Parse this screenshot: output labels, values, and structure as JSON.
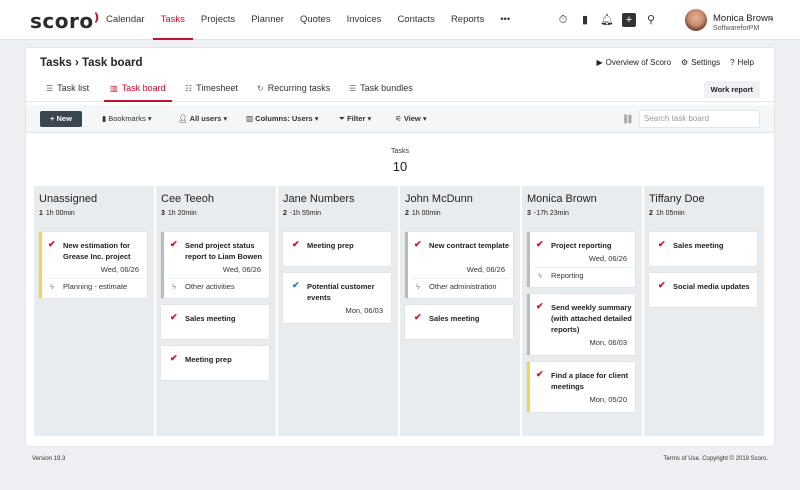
{
  "app": {
    "logo": "scoro"
  },
  "nav": {
    "items": [
      "Calendar",
      "Tasks",
      "Projects",
      "Planner",
      "Quotes",
      "Invoices",
      "Contacts",
      "Reports"
    ],
    "more": "•••",
    "active": "Tasks"
  },
  "top_icons": [
    "stopwatch-icon",
    "bookmark-icon",
    "bell-icon",
    "plus-icon",
    "search-icon"
  ],
  "user": {
    "name": "Monica Brown",
    "org": "SoftwareforPM",
    "caret": "⌄"
  },
  "page": {
    "breadcrumb": "Tasks › Task board",
    "overview": "Overview of Scoro",
    "settings": "Settings",
    "help": "Help"
  },
  "tabs": [
    {
      "label": "Task list",
      "icon": "list-icon"
    },
    {
      "label": "Task board",
      "icon": "board-icon"
    },
    {
      "label": "Timesheet",
      "icon": "timesheet-icon"
    },
    {
      "label": "Recurring tasks",
      "icon": "recurring-icon"
    },
    {
      "label": "Task bundles",
      "icon": "bundle-icon"
    }
  ],
  "work_report": "Work report",
  "toolbar": {
    "new_label": "+ New",
    "bookmarks": "Bookmarks",
    "all_users": "All users",
    "columns_prefix": "Columns:",
    "columns_value": "Users",
    "filter": "Filter",
    "view": "View",
    "search_placeholder": "Search task board"
  },
  "counter": {
    "label": "Tasks",
    "value": "10"
  },
  "columns": [
    {
      "name": "Unassigned",
      "count": "1",
      "time": "1h 00min",
      "cards": [
        {
          "title": "New estimation for Grease Inc. project",
          "date": "Wed, 06/26",
          "tag": "Planning - estimate",
          "border": "yellow",
          "check": "red"
        }
      ]
    },
    {
      "name": "Cee Teeoh",
      "count": "3",
      "time": "1h 20min",
      "cards": [
        {
          "title": "Send project status report to Liam Bowen",
          "date": "Wed, 06/26",
          "tag": "Other activities",
          "border": "gray",
          "check": "red"
        },
        {
          "title": "Sales meeting",
          "border": "none",
          "check": "red"
        },
        {
          "title": "Meeting prep",
          "border": "none",
          "check": "red"
        }
      ]
    },
    {
      "name": "Jane Numbers",
      "count": "2",
      "time": "-1h 55min",
      "cards": [
        {
          "title": "Meeting prep",
          "border": "none",
          "check": "red"
        },
        {
          "title": "Potential customer events",
          "date": "Mon, 06/03",
          "border": "none",
          "check": "blue"
        }
      ]
    },
    {
      "name": "John McDunn",
      "count": "2",
      "time": "1h 00min",
      "cards": [
        {
          "title": "New contract template",
          "date": "Wed, 06/26",
          "tag": "Other administration",
          "border": "gray",
          "check": "red"
        },
        {
          "title": "Sales meeting",
          "border": "none",
          "check": "red"
        }
      ]
    },
    {
      "name": "Monica Brown",
      "count": "3",
      "time": "-17h 23min",
      "cards": [
        {
          "title": "Project reporting",
          "date": "Wed, 06/26",
          "tag": "Reporting",
          "border": "gray",
          "check": "red"
        },
        {
          "title": "Send weekly summary (with attached detailed reports)",
          "date": "Mon, 06/03",
          "border": "gray",
          "check": "red"
        },
        {
          "title": "Find a place for client meetings",
          "date": "Mon, 05/20",
          "border": "yellow",
          "check": "red"
        }
      ]
    },
    {
      "name": "Tiffany Doe",
      "count": "2",
      "time": "1h 05min",
      "cards": [
        {
          "title": "Sales meeting",
          "border": "none",
          "check": "red"
        },
        {
          "title": "Social media updates",
          "border": "none",
          "check": "red"
        }
      ]
    }
  ],
  "footer": {
    "version": "Version 19.3",
    "copyright": "Terms of Use. Copyright © 2019 Scoro."
  },
  "colors": {
    "accent": "#c8102e",
    "yellow_border": "#f1d54b",
    "gray_border": "#b8bcc2",
    "dark_button": "#3c4652"
  }
}
